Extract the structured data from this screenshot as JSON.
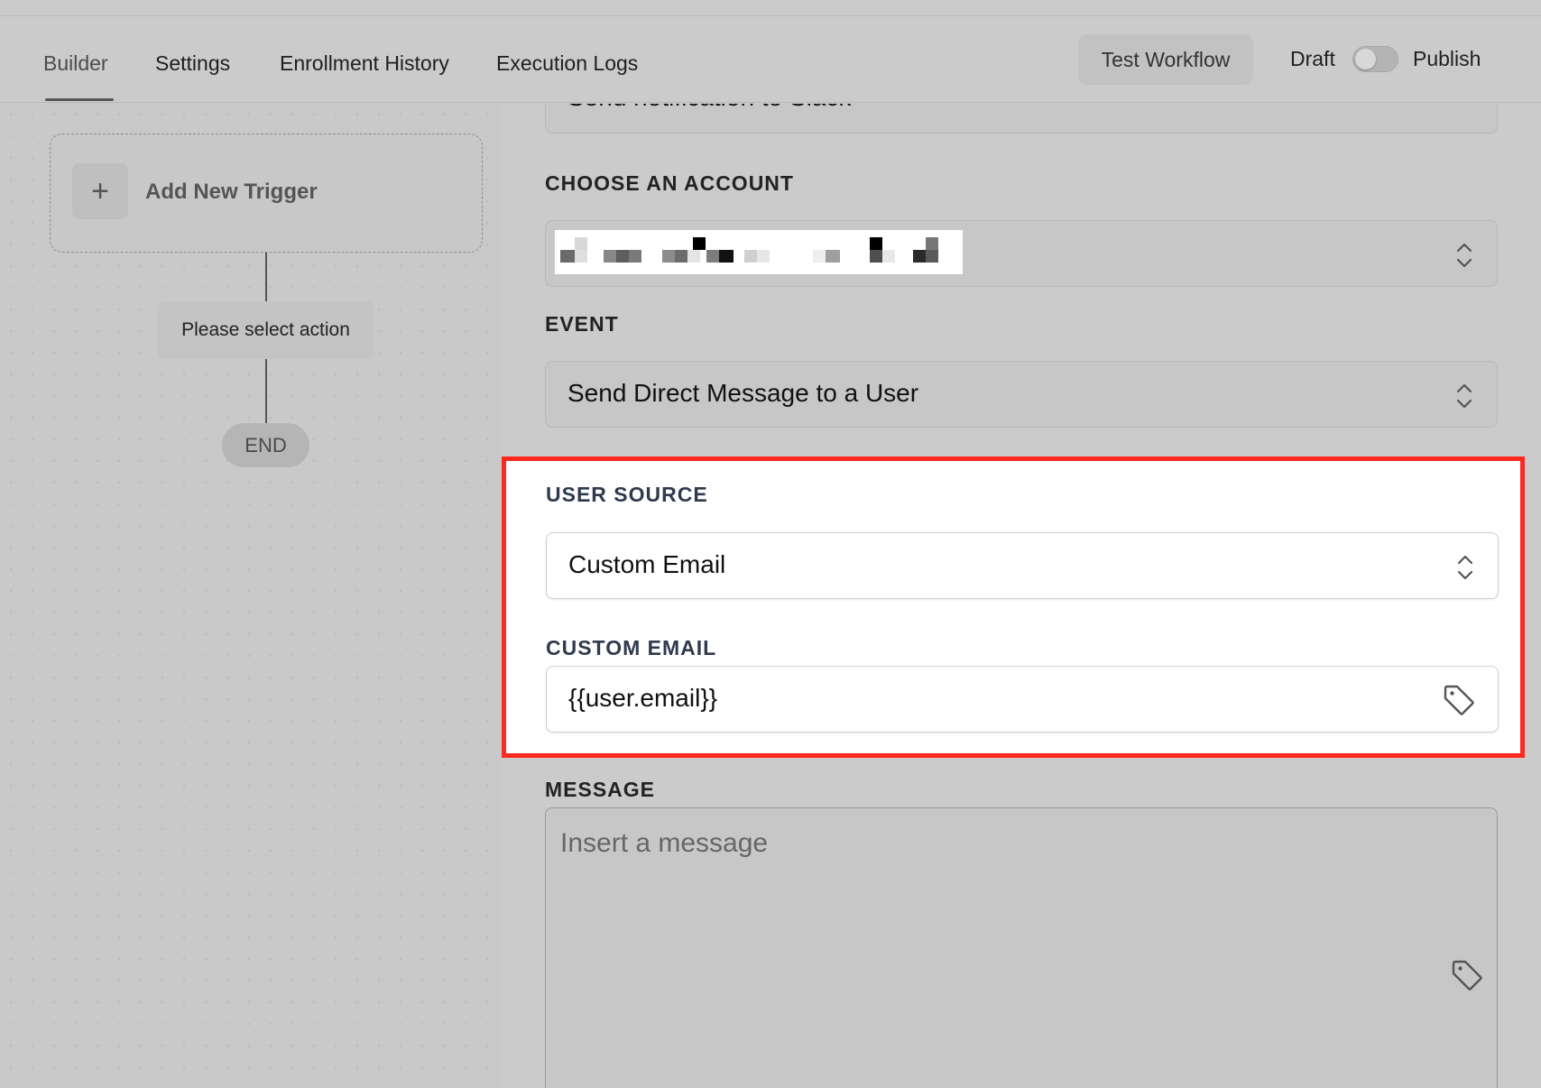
{
  "tabs": [
    {
      "label": "Builder",
      "active": true
    },
    {
      "label": "Settings",
      "active": false
    },
    {
      "label": "Enrollment History",
      "active": false
    },
    {
      "label": "Execution Logs",
      "active": false
    }
  ],
  "header": {
    "test_button": "Test Workflow",
    "draft_label": "Draft",
    "publish_label": "Publish",
    "publish_enabled": false
  },
  "canvas": {
    "add_trigger": "Add New Trigger",
    "plus": "+",
    "action_placeholder": "Please select action",
    "end_label": "END"
  },
  "form": {
    "action_name_value": "Send notification to Slack",
    "account": {
      "label": "CHOOSE AN ACCOUNT",
      "value": "(redacted)"
    },
    "event": {
      "label": "EVENT",
      "value": "Send Direct Message to a User"
    },
    "user_source": {
      "label": "USER SOURCE",
      "value": "Custom Email"
    },
    "custom_email": {
      "label": "CUSTOM EMAIL",
      "value": "{{user.email}}"
    },
    "message": {
      "label": "MESSAGE",
      "placeholder": "Insert a message"
    }
  },
  "colors": {
    "highlight_border": "#ff2a1f",
    "label_dark_blue": "#2f3a4d",
    "overlay_gray": "#cbcbcb"
  },
  "icons": [
    "plus-icon",
    "chevron-updown-icon",
    "tag-icon"
  ]
}
